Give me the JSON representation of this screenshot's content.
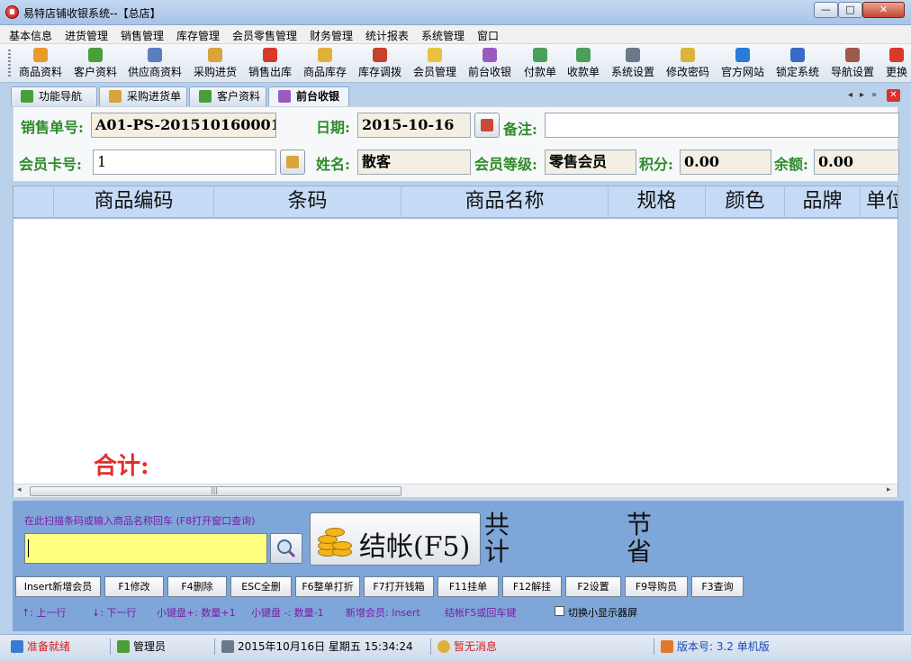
{
  "window": {
    "title": "易特店铺收银系统--【总店】",
    "minimize": "—",
    "maximize": "□",
    "close": "✕"
  },
  "menu": [
    "基本信息",
    "进货管理",
    "销售管理",
    "库存管理",
    "会员零售管理",
    "财务管理",
    "统计报表",
    "系统管理",
    "窗口"
  ],
  "toolbar": [
    {
      "label": "商品资料",
      "icon": "product-icon",
      "color": "#e89a2c"
    },
    {
      "label": "客户资料",
      "icon": "customer-icon",
      "color": "#4a9e3a"
    },
    {
      "label": "供应商资料",
      "icon": "supplier-icon",
      "color": "#5a7fc0"
    },
    {
      "label": "采购进货",
      "icon": "purchase-icon",
      "color": "#d9a43a"
    },
    {
      "label": "销售出库",
      "icon": "sales-out-icon",
      "color": "#d83a2a"
    },
    {
      "label": "商品库存",
      "icon": "stock-icon",
      "color": "#e0b03a"
    },
    {
      "label": "库存调拨",
      "icon": "transfer-icon",
      "color": "#c8402e"
    },
    {
      "label": "会员管理",
      "icon": "member-icon",
      "color": "#e8c23a"
    },
    {
      "label": "前台收银",
      "icon": "cashier-icon",
      "color": "#9a5ac0"
    },
    {
      "label": "付款单",
      "icon": "payment-icon",
      "color": "#4aa05a"
    },
    {
      "label": "收款单",
      "icon": "receipt-icon",
      "color": "#4aa05a"
    },
    {
      "label": "系统设置",
      "icon": "settings-icon",
      "color": "#6a7a8a"
    },
    {
      "label": "修改密码",
      "icon": "password-icon",
      "color": "#d9b43a"
    },
    {
      "label": "官方网站",
      "icon": "ie-icon",
      "color": "#2a7ad8"
    },
    {
      "label": "锁定系统",
      "icon": "lock-icon",
      "color": "#3a6ac8"
    },
    {
      "label": "导航设置",
      "icon": "nav-settings-icon",
      "color": "#a05a4a"
    },
    {
      "label": "更换",
      "icon": "switch-icon",
      "color": "#d83a2a"
    }
  ],
  "tabs": [
    {
      "label": "功能导航",
      "icon": "nav-icon",
      "color": "#4a9e3a"
    },
    {
      "label": "采购进货单",
      "icon": "purchase-order-icon",
      "color": "#d9a43a"
    },
    {
      "label": "客户资料",
      "icon": "customer-icon",
      "color": "#4a9e3a"
    },
    {
      "label": "前台收银",
      "icon": "cashier-icon",
      "color": "#9a5ac0"
    }
  ],
  "tab_nav": {
    "prev": "◂",
    "next": "▸",
    "more": "»",
    "close": "✕"
  },
  "form": {
    "order_no_label": "销售单号:",
    "order_no": "A01-PS-201510160001",
    "date_label": "日期:",
    "date": "2015-10-16",
    "remark_label": "备注:",
    "remark": "",
    "card_label": "会员卡号:",
    "card_no": "1",
    "name_label": "姓名:",
    "name": "散客",
    "level_label": "会员等级:",
    "level": "零售会员",
    "points_label": "积分:",
    "points": "0.00",
    "balance_label": "余额:",
    "balance": "0.00"
  },
  "grid": {
    "columns": [
      "",
      "商品编码",
      "条码",
      "商品名称",
      "规格",
      "颜色",
      "品牌",
      "单位"
    ],
    "total_label": "合计:",
    "scroll_left": "◂",
    "scroll_right": "▸",
    "thumb_grip": "|||"
  },
  "checkout": {
    "hint": "在此扫描条码或输入商品名称回车 (F8打开窗口查询)",
    "scan_value": "",
    "button_label": "结帐(F5)",
    "total_text": "共计",
    "saved_text": "节省"
  },
  "fkeys": [
    "Insert新增会员",
    "F1修改",
    "F4删除",
    "ESC全删",
    "F6整单打折",
    "F7打开钱箱",
    "F11挂单",
    "F12解挂",
    "F2设置",
    "F9导购员",
    "F3查询"
  ],
  "tips": {
    "up": "↑: 上一行",
    "down": "↓: 下一行",
    "plus": "小键盘+: 数量+1",
    "minus": "小键盘 -: 数量-1",
    "new_member": "新增会员: Insert",
    "checkout": "结帐F5或回车键",
    "switch_display": "切换小显示器屏"
  },
  "status": {
    "ready": "准备就绪",
    "user": "管理员",
    "datetime": "2015年10月16日  星期五    15:34:24",
    "message": "暂无消息",
    "version": "版本号: 3.2 单机版"
  },
  "colors": {
    "label_green": "#2f8a2a",
    "total_red": "#e0302a",
    "panel_blue": "#7fa6d8",
    "scan_yellow": "#ffff80",
    "hint_purple": "#7c1aa8"
  }
}
